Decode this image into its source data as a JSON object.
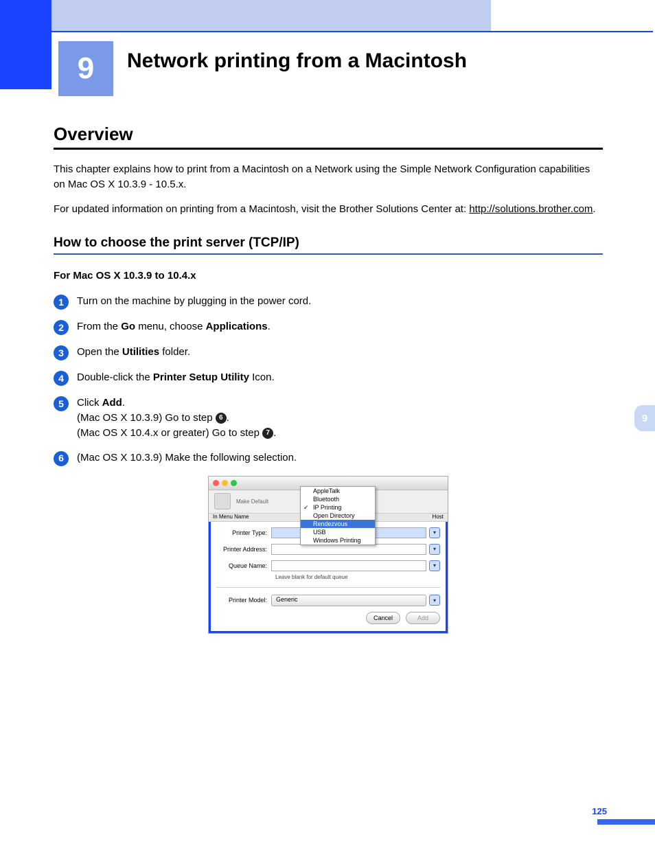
{
  "chapter": {
    "number": "9",
    "title": "Network printing from a Macintosh"
  },
  "section": {
    "heading": "Overview",
    "para1": "This chapter explains how to print from a Macintosh on a Network using the Simple Network Configuration capabilities on Mac OS X 10.3.9 - 10.5.x.",
    "para2_prefix": "For updated information on printing from a Macintosh, visit the Brother Solutions Center at: ",
    "para2_link": "http://solutions.brother.com",
    "para2_suffix": "."
  },
  "subsection": {
    "heading": "How to choose the print server (TCP/IP)",
    "os_heading": "For Mac OS X 10.3.9 to 10.4.x"
  },
  "steps": [
    {
      "n": "1",
      "text_pre": "Turn on the machine by plugging in the power cord."
    },
    {
      "n": "2",
      "text_pre": "From the ",
      "b1": "Go",
      "mid1": " menu, choose ",
      "b2": "Applications",
      "suffix": "."
    },
    {
      "n": "3",
      "text_pre": "Open the ",
      "b1": "Utilities",
      "suffix": " folder."
    },
    {
      "n": "4",
      "text_pre": "Double-click the ",
      "b1": "Printer Setup Utility",
      "suffix": " Icon."
    },
    {
      "n": "5",
      "text_pre": "Click ",
      "b1": "Add",
      "suffix": ".",
      "line2_pre": "(Mac OS X 10.3.9) Go to step ",
      "line2_badge": "6",
      "line2_suf": ".",
      "line3_pre": "(Mac OS X 10.4.x or greater) Go to step ",
      "line3_badge": "7",
      "line3_suf": "."
    },
    {
      "n": "6",
      "text_pre": "(Mac OS X 10.3.9) Make the following selection."
    }
  ],
  "mac_dialog": {
    "toolbar_label": "Make Default",
    "col_left": "In Menu   Name",
    "col_right": "Host",
    "dropdown": [
      "AppleTalk",
      "Bluetooth",
      "IP Printing",
      "Open Directory",
      "Rendezvous",
      "USB",
      "Windows Printing"
    ],
    "dropdown_checked": "IP Printing",
    "dropdown_selected": "Rendezvous",
    "labels": {
      "printer_type": "Printer Type:",
      "printer_address": "Printer Address:",
      "queue_name": "Queue Name:",
      "queue_hint": "Leave blank for default queue",
      "printer_model": "Printer Model:",
      "model_value": "Generic"
    },
    "buttons": {
      "cancel": "Cancel",
      "add": "Add"
    }
  },
  "side_tab": "9",
  "page_number": "125"
}
